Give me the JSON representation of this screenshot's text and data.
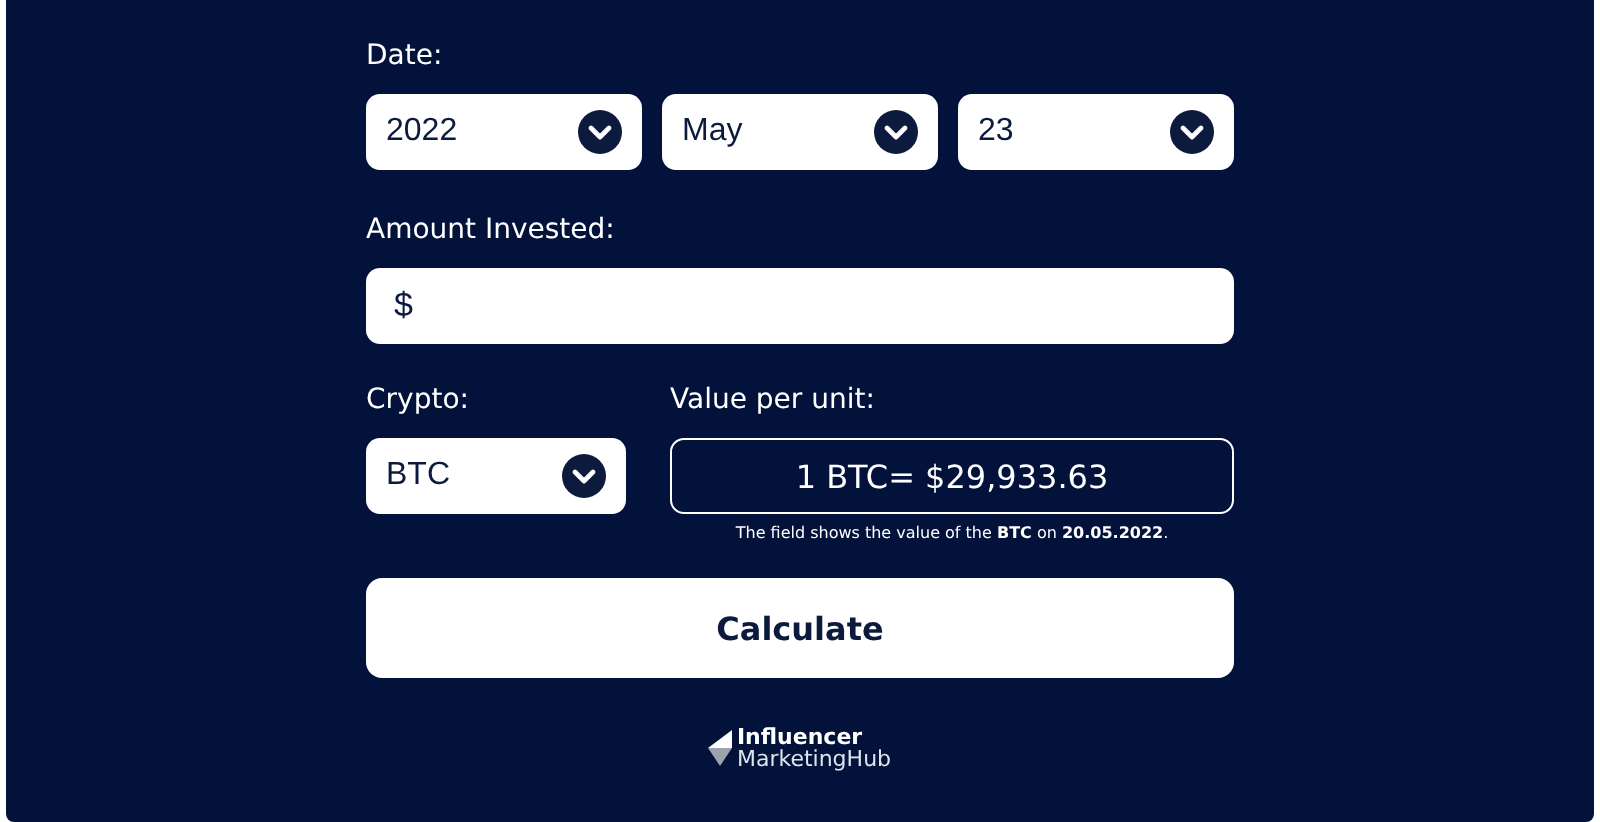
{
  "date": {
    "label": "Date:",
    "selects": [
      {
        "value": "2022"
      },
      {
        "value": "May"
      },
      {
        "value": "23"
      }
    ]
  },
  "amount": {
    "label": "Amount Invested:",
    "prefix": "$"
  },
  "crypto": {
    "label": "Crypto:",
    "value": "BTC"
  },
  "value_per_unit": {
    "label": "Value per unit:",
    "value": "1 BTC= $29,933.63",
    "note": "The field shows the value of the **BTC** on **20.05.2022**."
  },
  "button": "Calculate",
  "logo": {
    "line_1": "Influencer",
    "line_2": "MarketingHub"
  }
}
